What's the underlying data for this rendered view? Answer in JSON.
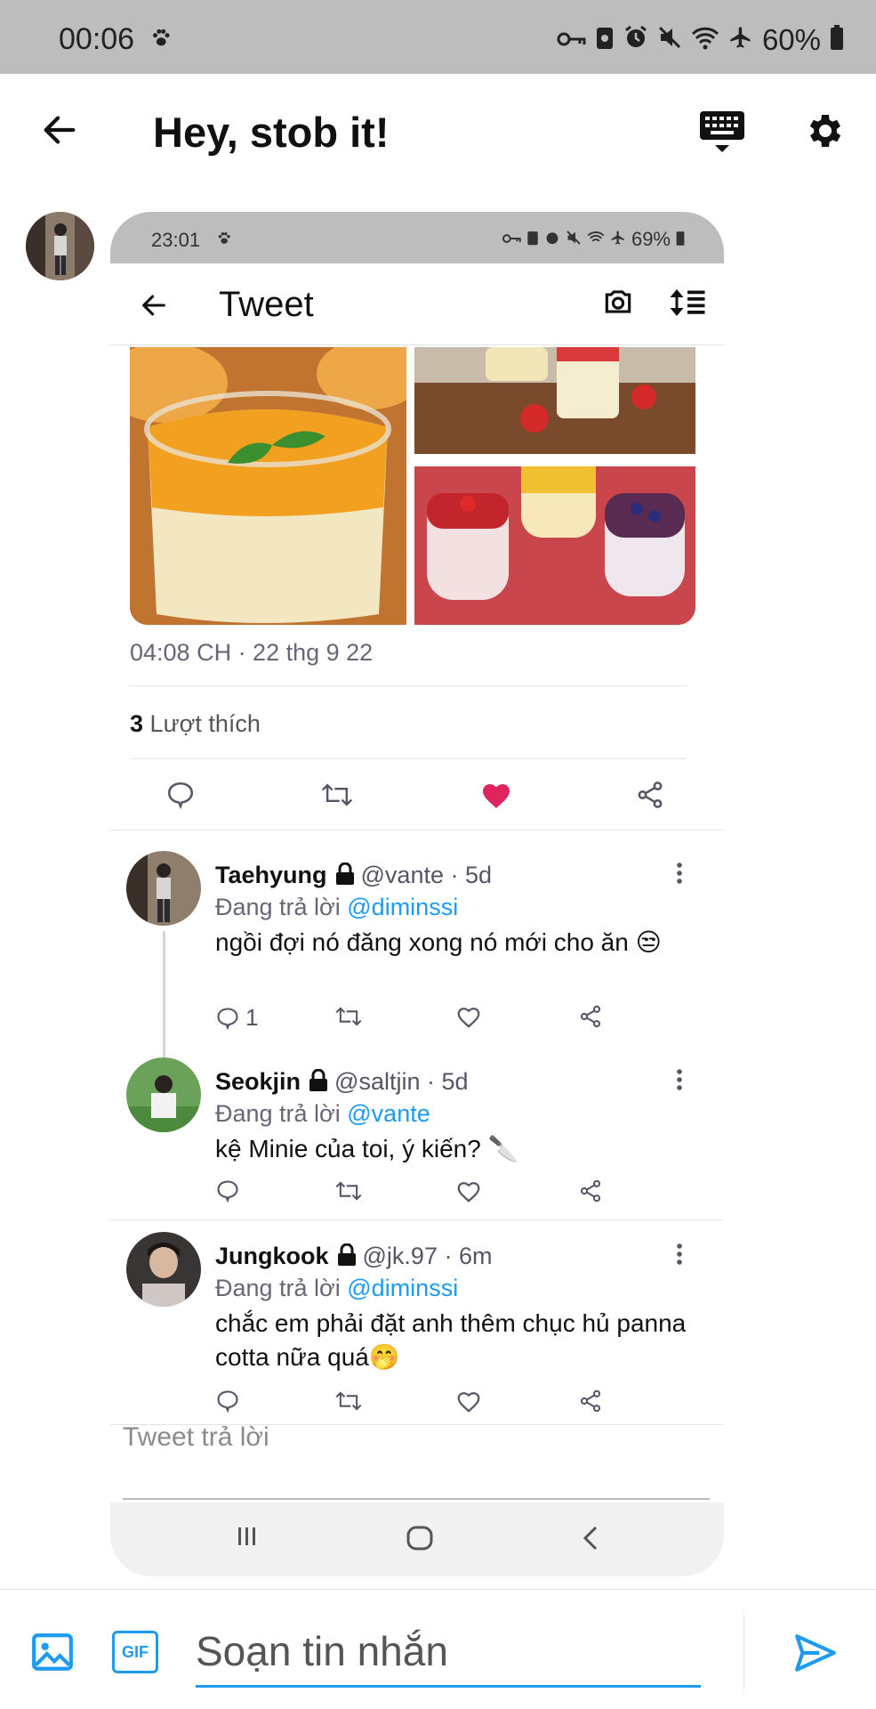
{
  "status_bar": {
    "time": "00:06",
    "battery": "60%"
  },
  "header": {
    "title": "Hey, stob it!"
  },
  "embedded": {
    "status_bar": {
      "time": "23:01",
      "battery": "69%"
    },
    "header": {
      "title": "Tweet"
    },
    "timestamp": "04:08 CH · 22 thg 9 22",
    "likes_count": "3",
    "likes_label": "Lượt thích",
    "replies": [
      {
        "name": "Taehyung",
        "handle": "@vante · 5d",
        "replying_prefix": "Đang trả lời ",
        "replying_to": "@diminssi",
        "text": "ngồi đợi nó đăng xong nó mới cho ăn 😒",
        "reply_count": "1"
      },
      {
        "name": "Seokjin",
        "handle": "@saltjin · 5d",
        "replying_prefix": "Đang trả lời ",
        "replying_to": "@vante",
        "text": "kệ Minie của toi, ý kiến? 🔪",
        "reply_count": ""
      },
      {
        "name": "Jungkook",
        "handle": "@jk.97 · 6m",
        "replying_prefix": "Đang trả lời ",
        "replying_to": "@diminssi",
        "text": "chắc em phải đặt anh thêm chục hủ panna cotta nữa quá🤭",
        "reply_count": ""
      }
    ],
    "reply_placeholder": "Tweet trả lời"
  },
  "composer": {
    "gif_label": "GIF",
    "placeholder": "Soạn tin nhắn"
  },
  "colors": {
    "accent": "#1d9bf0",
    "like": "#e0245e"
  }
}
